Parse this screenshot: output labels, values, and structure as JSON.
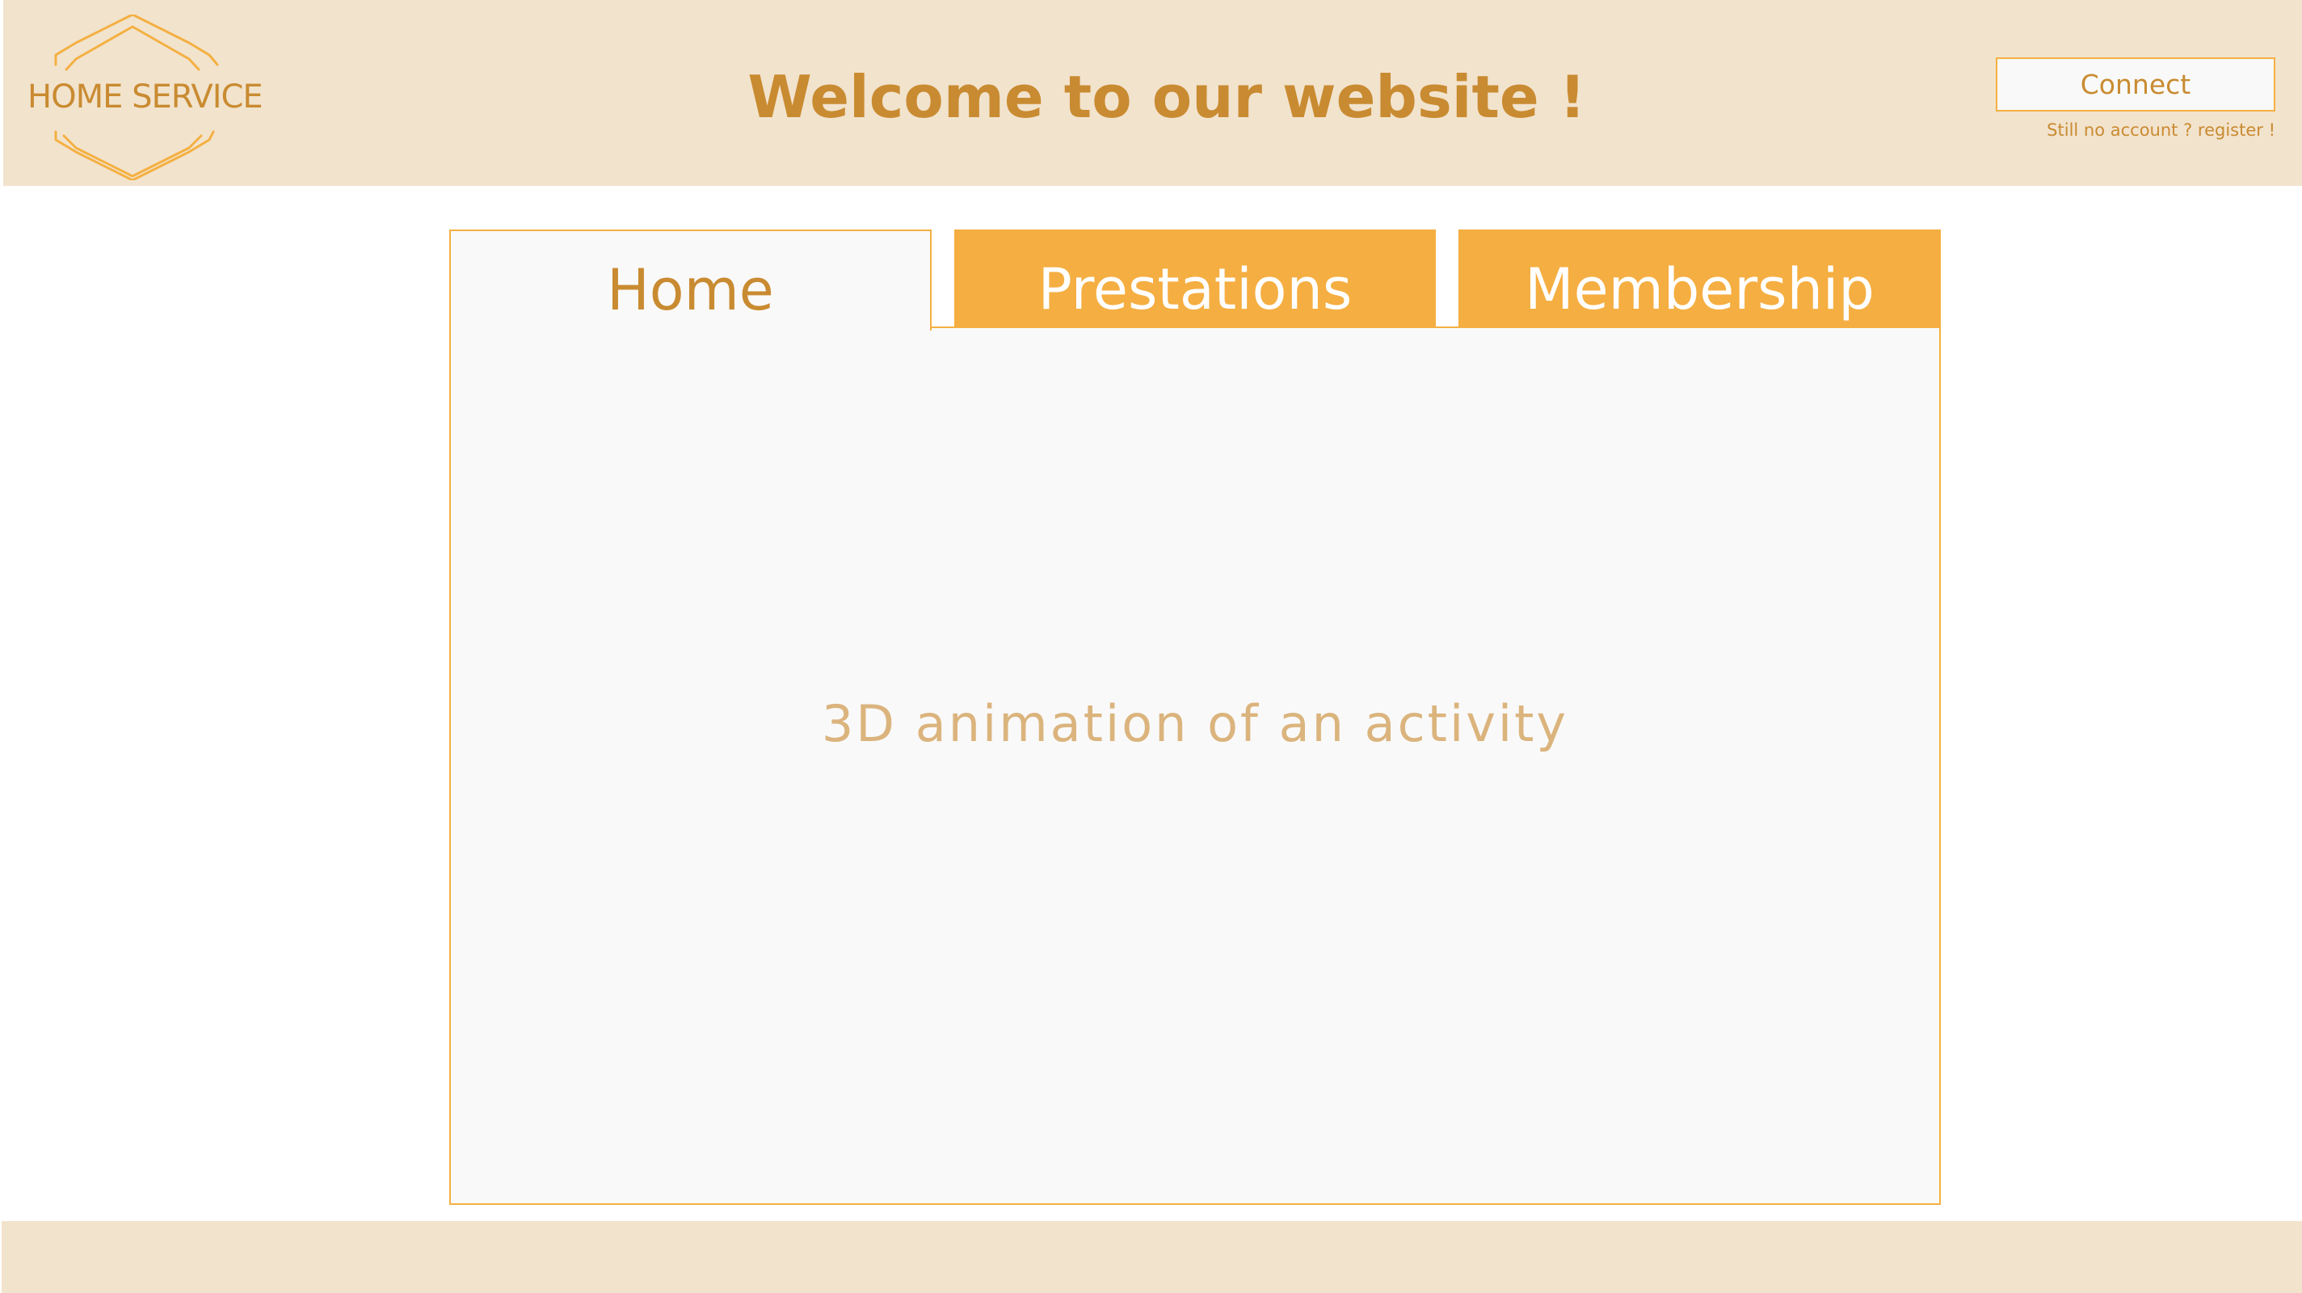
{
  "brand": {
    "name": "HOME SERVICE",
    "logo_icon": "hexagon-outline-icon",
    "accent_color": "#f5ae41",
    "text_color": "#c98b31",
    "header_bg": "#f2e3cd"
  },
  "header": {
    "title": "Welcome to our website !",
    "connect_label": "Connect",
    "register_label": "Still no account ? register !"
  },
  "tabs": [
    {
      "label": "Home",
      "active": true
    },
    {
      "label": "Prestations",
      "active": false
    },
    {
      "label": "Membership",
      "active": false
    }
  ],
  "main": {
    "placeholder_text": "3D animation of an activity"
  }
}
